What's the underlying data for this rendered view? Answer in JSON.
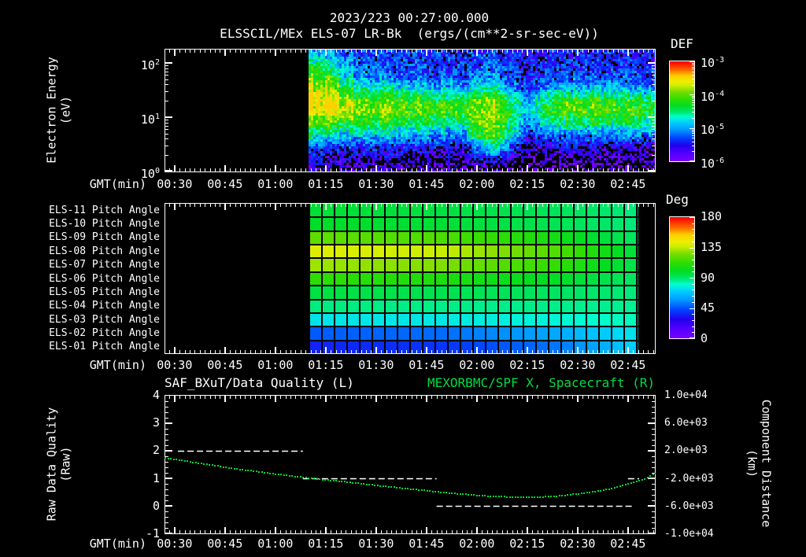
{
  "title": "2023/223 00:27:00.000",
  "subtitle": "ELSSCIL/MEx ELS-07 LR-Bk  (ergs/(cm**2-sr-sec-eV))",
  "colors": {
    "text": "#ffffff",
    "title_green": "#00dd44",
    "curve_green": "#00d935",
    "background": "#000000"
  },
  "colormap": [
    [
      0.0,
      "#7a00ff"
    ],
    [
      0.08,
      "#5500ff"
    ],
    [
      0.16,
      "#2200ee"
    ],
    [
      0.24,
      "#0044ff"
    ],
    [
      0.32,
      "#0099ff"
    ],
    [
      0.39,
      "#00ccff"
    ],
    [
      0.45,
      "#00ffcc"
    ],
    [
      0.5,
      "#00e668"
    ],
    [
      0.56,
      "#00dd22"
    ],
    [
      0.63,
      "#33dd00"
    ],
    [
      0.7,
      "#77dd00"
    ],
    [
      0.76,
      "#ccee00"
    ],
    [
      0.8,
      "#eeee00"
    ],
    [
      0.86,
      "#ffcc00"
    ],
    [
      0.92,
      "#ff6600"
    ],
    [
      1.0,
      "#ff0000"
    ]
  ],
  "axis": {
    "xlabel": "GMT(min)",
    "t_start_min": 27,
    "t_end_min": 173,
    "time_ticks": [
      {
        "label": "00:30",
        "min": 30
      },
      {
        "label": "00:45",
        "min": 45
      },
      {
        "label": "01:00",
        "min": 60
      },
      {
        "label": "01:15",
        "min": 75
      },
      {
        "label": "01:30",
        "min": 90
      },
      {
        "label": "01:45",
        "min": 105
      },
      {
        "label": "02:00",
        "min": 120
      },
      {
        "label": "02:15",
        "min": 135
      },
      {
        "label": "02:30",
        "min": 150
      },
      {
        "label": "02:45",
        "min": 165
      }
    ],
    "minor_tick_min": 1.5
  },
  "chart_data": [
    {
      "type": "heatmap",
      "name": "electron_energy_spectrogram",
      "ylabel_line1": "Electron Energy",
      "ylabel_line2": "(eV)",
      "yticks": [
        {
          "base": "10",
          "exp": "2",
          "logE": 2
        },
        {
          "base": "10",
          "exp": "1",
          "logE": 1
        },
        {
          "base": "10",
          "exp": "0",
          "logE": 0
        }
      ],
      "y_log_range": [
        0,
        2.26
      ],
      "colorbar": {
        "title": "DEF",
        "ticks": [
          {
            "base": "10",
            "exp": "-3"
          },
          {
            "base": "10",
            "exp": "-4"
          },
          {
            "base": "10",
            "exp": "-5"
          },
          {
            "base": "10",
            "exp": "-6"
          }
        ]
      },
      "log_flux_range": [
        -6,
        -3
      ],
      "data_t_start": 70,
      "data_t_end": 173,
      "grid_times": [
        70,
        75,
        80,
        85,
        90,
        95,
        100,
        105,
        110,
        115,
        120,
        125,
        130,
        135,
        140,
        145,
        150,
        155,
        160,
        165,
        170
      ],
      "grid_logE": [
        2.26,
        2.0,
        1.75,
        1.5,
        1.3,
        1.1,
        0.9,
        0.65,
        0.4,
        0.1
      ],
      "grid_values": [
        [
          -5.0,
          -4.6,
          -4.3,
          -4.0,
          -3.7,
          -3.7,
          -4.1,
          -4.7,
          -5.4,
          -5.7
        ],
        [
          -5.1,
          -4.7,
          -4.4,
          -4.0,
          -3.7,
          -3.7,
          -4.1,
          -4.8,
          -5.5,
          -5.8
        ],
        [
          -5.3,
          -5.0,
          -4.8,
          -4.4,
          -3.9,
          -3.8,
          -4.2,
          -4.9,
          -5.5,
          -5.8
        ],
        [
          -5.35,
          -5.2,
          -5.0,
          -4.5,
          -4.0,
          -3.9,
          -4.3,
          -4.9,
          -5.5,
          -5.8
        ],
        [
          -5.35,
          -5.25,
          -5.1,
          -4.6,
          -4.0,
          -3.9,
          -4.3,
          -4.9,
          -5.5,
          -5.8
        ],
        [
          -5.35,
          -5.3,
          -5.2,
          -4.6,
          -4.0,
          -3.95,
          -4.35,
          -4.9,
          -5.5,
          -5.8
        ],
        [
          -5.4,
          -5.3,
          -5.2,
          -4.7,
          -4.05,
          -4.0,
          -4.4,
          -5.0,
          -5.6,
          -5.9
        ],
        [
          -5.4,
          -5.3,
          -5.25,
          -4.75,
          -4.1,
          -4.05,
          -4.45,
          -5.0,
          -5.6,
          -5.9
        ],
        [
          -5.4,
          -5.35,
          -5.3,
          -4.8,
          -4.2,
          -4.1,
          -4.5,
          -5.1,
          -5.6,
          -5.9
        ],
        [
          -5.45,
          -5.4,
          -5.35,
          -4.9,
          -4.3,
          -4.2,
          -4.6,
          -5.2,
          -5.7,
          -5.9
        ],
        [
          -5.4,
          -5.3,
          -5.15,
          -4.7,
          -4.1,
          -4.0,
          -4.1,
          -4.4,
          -5.2,
          -5.9
        ],
        [
          -5.3,
          -5.2,
          -5.0,
          -4.4,
          -3.85,
          -3.8,
          -3.85,
          -4.05,
          -4.8,
          -5.9
        ],
        [
          -5.45,
          -5.4,
          -5.3,
          -5.0,
          -4.4,
          -4.3,
          -4.4,
          -4.7,
          -5.4,
          -6.0
        ],
        [
          -5.55,
          -5.55,
          -5.5,
          -5.3,
          -5.0,
          -4.9,
          -5.1,
          -5.5,
          -5.8,
          -6.1
        ],
        [
          -5.5,
          -5.45,
          -5.4,
          -5.1,
          -4.5,
          -4.4,
          -4.7,
          -5.3,
          -5.7,
          -6.0
        ],
        [
          -5.45,
          -5.4,
          -5.3,
          -4.9,
          -4.2,
          -4.1,
          -4.5,
          -5.2,
          -5.7,
          -6.0
        ],
        [
          -5.45,
          -5.4,
          -5.3,
          -4.85,
          -4.1,
          -4.05,
          -4.45,
          -5.2,
          -5.7,
          -6.0
        ],
        [
          -5.45,
          -5.4,
          -5.3,
          -4.85,
          -4.1,
          -4.05,
          -4.45,
          -5.2,
          -5.7,
          -6.0
        ],
        [
          -5.5,
          -5.4,
          -5.3,
          -4.9,
          -4.2,
          -4.1,
          -4.5,
          -5.2,
          -5.75,
          -6.0
        ],
        [
          -5.5,
          -5.4,
          -5.3,
          -4.9,
          -4.2,
          -4.1,
          -4.4,
          -5.1,
          -5.75,
          -6.0
        ],
        [
          -5.5,
          -5.45,
          -5.35,
          -5.0,
          -4.3,
          -4.2,
          -4.5,
          -5.2,
          -5.8,
          -6.0
        ]
      ]
    },
    {
      "type": "heatmap",
      "name": "pitch_angle_panel",
      "colorbar": {
        "title": "Deg",
        "ticks": [
          "180",
          "135",
          "90",
          "45",
          "0"
        ]
      },
      "value_range": [
        0,
        180
      ],
      "data_t_start": 70,
      "data_t_end": 168,
      "control_times": [
        70,
        110,
        145,
        168
      ],
      "rows": [
        {
          "label": "ELS-11 Pitch Angle",
          "values": [
            98,
            96,
            92,
            88
          ]
        },
        {
          "label": "ELS-10 Pitch Angle",
          "values": [
            100,
            98,
            93,
            88
          ]
        },
        {
          "label": "ELS-09 Pitch Angle",
          "values": [
            122,
            118,
            105,
            90
          ]
        },
        {
          "label": "ELS-08 Pitch Angle",
          "values": [
            141,
            136,
            118,
            95
          ]
        },
        {
          "label": "ELS-07 Pitch Angle",
          "values": [
            131,
            127,
            112,
            93
          ]
        },
        {
          "label": "ELS-06 Pitch Angle",
          "values": [
            112,
            108,
            100,
            90
          ]
        },
        {
          "label": "ELS-05 Pitch Angle",
          "values": [
            96,
            94,
            91,
            88
          ]
        },
        {
          "label": "ELS-04 Pitch Angle",
          "values": [
            88,
            87,
            87,
            86
          ]
        },
        {
          "label": "ELS-03 Pitch Angle",
          "values": [
            75,
            76,
            79,
            83
          ]
        },
        {
          "label": "ELS-02 Pitch Angle",
          "values": [
            47,
            50,
            62,
            76
          ]
        },
        {
          "label": "ELS-01 Pitch Angle",
          "values": [
            36,
            40,
            52,
            72
          ]
        }
      ]
    },
    {
      "type": "line",
      "name": "quality_and_distance",
      "title_left": "SAF_BXuT/Data Quality (L)",
      "title_right": "MEXORBMC/SPF X, Spacecraft (R)",
      "ylabel_left_line1": "Raw Data Quality",
      "ylabel_left_line2": "(Raw)",
      "ylabel_right_line1": "Component Distance",
      "ylabel_right_line2": "(km)",
      "yticks_left": [
        "4",
        "3",
        "2",
        "1",
        "0",
        "-1"
      ],
      "yticks_right": [
        "1.0e+04",
        "6.0e+03",
        "2.0e+03",
        "-2.0e+03",
        "-6.0e+03",
        "-1.0e+04"
      ],
      "ylim_left": [
        -1,
        4
      ],
      "ylim_right": [
        -10000,
        10000
      ],
      "quality_segments": [
        {
          "t0": 31,
          "t1": 68.2,
          "value": 2
        },
        {
          "t0": 68.2,
          "t1": 108,
          "value": 1
        },
        {
          "t0": 108,
          "t1": 166.5,
          "value": 0
        },
        {
          "t0": 165,
          "t1": 168.3,
          "value": 1
        }
      ],
      "distance_curve_raw": [
        [
          27,
          1.76
        ],
        [
          36.6,
          1.58
        ],
        [
          48.3,
          1.37
        ],
        [
          60,
          1.18
        ],
        [
          71.8,
          1.01
        ],
        [
          83.5,
          0.86
        ],
        [
          95.2,
          0.7
        ],
        [
          104.6,
          0.58
        ],
        [
          113.9,
          0.47
        ],
        [
          123.3,
          0.38
        ],
        [
          132.7,
          0.35
        ],
        [
          142,
          0.37
        ],
        [
          151.4,
          0.49
        ],
        [
          158.4,
          0.62
        ],
        [
          165.5,
          0.84
        ],
        [
          170.2,
          1.03
        ],
        [
          173,
          1.2
        ]
      ]
    }
  ]
}
